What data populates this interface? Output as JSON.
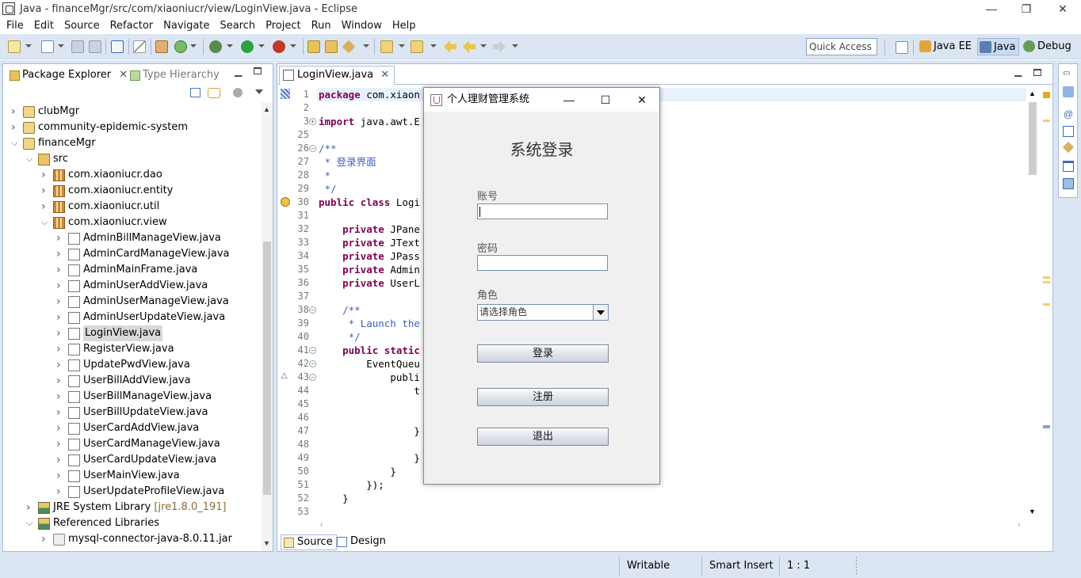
{
  "window": {
    "title": "Java - financeMgr/src/com/xiaoniucr/view/LoginView.java - Eclipse",
    "minimize": "—",
    "restore": "❐",
    "close": "✕"
  },
  "menu": [
    "File",
    "Edit",
    "Source",
    "Refactor",
    "Navigate",
    "Search",
    "Project",
    "Run",
    "Window",
    "Help"
  ],
  "toolbar": {
    "quick_access": "Quick Access",
    "perspectives": [
      "Java EE",
      "Java",
      "Debug"
    ],
    "active_perspective": "Java"
  },
  "package_explorer": {
    "tab_active": "Package Explorer",
    "tab_inactive": "Type Hierarchy",
    "tree": [
      {
        "label": "clubMgr",
        "level": 0,
        "expanded": false,
        "icon": "project-icon"
      },
      {
        "label": "community-epidemic-system",
        "level": 0,
        "expanded": false,
        "icon": "project-icon"
      },
      {
        "label": "financeMgr",
        "level": 0,
        "expanded": true,
        "icon": "project-icon"
      },
      {
        "label": "src",
        "level": 1,
        "expanded": true,
        "icon": "source-folder-icon"
      },
      {
        "label": "com.xiaoniucr.dao",
        "level": 2,
        "expanded": false,
        "icon": "package-icon"
      },
      {
        "label": "com.xiaoniucr.entity",
        "level": 2,
        "expanded": false,
        "icon": "package-icon"
      },
      {
        "label": "com.xiaoniucr.util",
        "level": 2,
        "expanded": false,
        "icon": "package-icon"
      },
      {
        "label": "com.xiaoniucr.view",
        "level": 2,
        "expanded": true,
        "icon": "package-icon"
      },
      {
        "label": "AdminBillManageView.java",
        "level": 3,
        "expanded": false,
        "icon": "java-file-icon"
      },
      {
        "label": "AdminCardManageView.java",
        "level": 3,
        "expanded": false,
        "icon": "java-file-icon"
      },
      {
        "label": "AdminMainFrame.java",
        "level": 3,
        "expanded": false,
        "icon": "java-file-icon"
      },
      {
        "label": "AdminUserAddView.java",
        "level": 3,
        "expanded": false,
        "icon": "java-file-icon"
      },
      {
        "label": "AdminUserManageView.java",
        "level": 3,
        "expanded": false,
        "icon": "java-file-icon"
      },
      {
        "label": "AdminUserUpdateView.java",
        "level": 3,
        "expanded": false,
        "icon": "java-file-icon"
      },
      {
        "label": "LoginView.java",
        "level": 3,
        "expanded": false,
        "icon": "java-file-icon",
        "selected": true
      },
      {
        "label": "RegisterView.java",
        "level": 3,
        "expanded": false,
        "icon": "java-file-icon"
      },
      {
        "label": "UpdatePwdView.java",
        "level": 3,
        "expanded": false,
        "icon": "java-file-icon"
      },
      {
        "label": "UserBillAddView.java",
        "level": 3,
        "expanded": false,
        "icon": "java-file-icon"
      },
      {
        "label": "UserBillManageView.java",
        "level": 3,
        "expanded": false,
        "icon": "java-file-icon"
      },
      {
        "label": "UserBillUpdateView.java",
        "level": 3,
        "expanded": false,
        "icon": "java-file-icon"
      },
      {
        "label": "UserCardAddView.java",
        "level": 3,
        "expanded": false,
        "icon": "java-file-icon"
      },
      {
        "label": "UserCardManageView.java",
        "level": 3,
        "expanded": false,
        "icon": "java-file-icon"
      },
      {
        "label": "UserCardUpdateView.java",
        "level": 3,
        "expanded": false,
        "icon": "java-file-icon"
      },
      {
        "label": "UserMainView.java",
        "level": 3,
        "expanded": false,
        "icon": "java-file-icon"
      },
      {
        "label": "UserUpdateProfileView.java",
        "level": 3,
        "expanded": false,
        "icon": "java-file-icon"
      },
      {
        "label": "JRE System Library",
        "decoration": "[jre1.8.0_191]",
        "level": 1,
        "expanded": false,
        "icon": "library-icon"
      },
      {
        "label": "Referenced Libraries",
        "level": 1,
        "expanded": true,
        "icon": "library-icon"
      },
      {
        "label": "mysql-connector-java-8.0.11.jar",
        "level": 2,
        "expanded": false,
        "icon": "jar-icon"
      }
    ]
  },
  "editor": {
    "tab_label": "LoginView.java",
    "lines": [
      {
        "n": "1",
        "text": "package com.xiaon"
      },
      {
        "n": "2",
        "text": ""
      },
      {
        "n": "3",
        "text": "import java.awt.E"
      },
      {
        "n": "25",
        "text": ""
      },
      {
        "n": "26",
        "text": "/**"
      },
      {
        "n": "27",
        "text": " * 登录界面"
      },
      {
        "n": "28",
        "text": " *"
      },
      {
        "n": "29",
        "text": " */"
      },
      {
        "n": "30",
        "text": "public class Logi"
      },
      {
        "n": "31",
        "text": ""
      },
      {
        "n": "32",
        "text": "    private JPane"
      },
      {
        "n": "33",
        "text": "    private JText"
      },
      {
        "n": "34",
        "text": "    private JPass"
      },
      {
        "n": "35",
        "text": "    private Admin"
      },
      {
        "n": "36",
        "text": "    private UserL"
      },
      {
        "n": "37",
        "text": ""
      },
      {
        "n": "38",
        "text": "    /**"
      },
      {
        "n": "39",
        "text": "     * Launch the"
      },
      {
        "n": "40",
        "text": "     */"
      },
      {
        "n": "41",
        "text": "    public static"
      },
      {
        "n": "42",
        "text": "        EventQueu"
      },
      {
        "n": "43",
        "text": "            publi"
      },
      {
        "n": "44",
        "text": "                t"
      },
      {
        "n": "45",
        "text": ""
      },
      {
        "n": "46",
        "text": ""
      },
      {
        "n": "47",
        "text": "                }"
      },
      {
        "n": "48",
        "text": ""
      },
      {
        "n": "49",
        "text": "                }"
      },
      {
        "n": "50",
        "text": "            }"
      },
      {
        "n": "51",
        "text": "        });"
      },
      {
        "n": "52",
        "text": "    }"
      },
      {
        "n": "53",
        "text": ""
      }
    ],
    "bottom_tabs": [
      "Source",
      "Design"
    ]
  },
  "status": {
    "writable": "Writable",
    "insert_mode": "Smart Insert",
    "position": "1 : 1"
  },
  "dialog": {
    "title": "个人理财管理系统",
    "heading": "系统登录",
    "account_label": "账号",
    "account_value": "",
    "password_label": "密码",
    "password_value": "",
    "role_label": "角色",
    "role_selected": "请选择角色",
    "login_button": "登录",
    "register_button": "注册",
    "exit_button": "退出",
    "minimize": "—",
    "maximize": "☐",
    "close": "✕"
  }
}
